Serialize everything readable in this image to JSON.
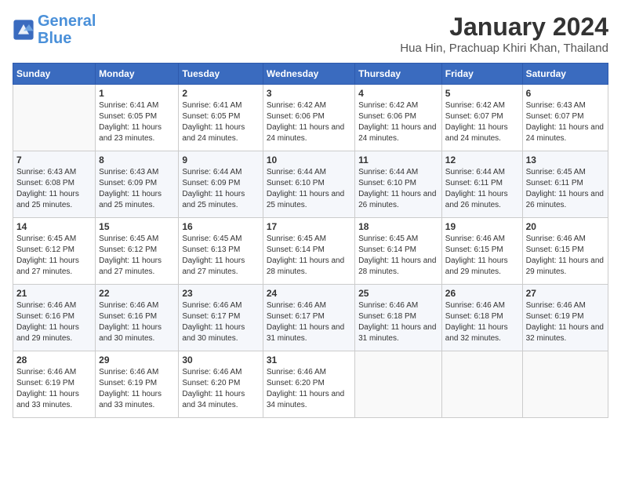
{
  "logo": {
    "line1": "General",
    "line2": "Blue"
  },
  "title": "January 2024",
  "subtitle": "Hua Hin, Prachuap Khiri Khan, Thailand",
  "headers": [
    "Sunday",
    "Monday",
    "Tuesday",
    "Wednesday",
    "Thursday",
    "Friday",
    "Saturday"
  ],
  "weeks": [
    [
      {
        "day": "",
        "sunrise": "",
        "sunset": "",
        "daylight": ""
      },
      {
        "day": "1",
        "sunrise": "Sunrise: 6:41 AM",
        "sunset": "Sunset: 6:05 PM",
        "daylight": "Daylight: 11 hours and 23 minutes."
      },
      {
        "day": "2",
        "sunrise": "Sunrise: 6:41 AM",
        "sunset": "Sunset: 6:05 PM",
        "daylight": "Daylight: 11 hours and 24 minutes."
      },
      {
        "day": "3",
        "sunrise": "Sunrise: 6:42 AM",
        "sunset": "Sunset: 6:06 PM",
        "daylight": "Daylight: 11 hours and 24 minutes."
      },
      {
        "day": "4",
        "sunrise": "Sunrise: 6:42 AM",
        "sunset": "Sunset: 6:06 PM",
        "daylight": "Daylight: 11 hours and 24 minutes."
      },
      {
        "day": "5",
        "sunrise": "Sunrise: 6:42 AM",
        "sunset": "Sunset: 6:07 PM",
        "daylight": "Daylight: 11 hours and 24 minutes."
      },
      {
        "day": "6",
        "sunrise": "Sunrise: 6:43 AM",
        "sunset": "Sunset: 6:07 PM",
        "daylight": "Daylight: 11 hours and 24 minutes."
      }
    ],
    [
      {
        "day": "7",
        "sunrise": "Sunrise: 6:43 AM",
        "sunset": "Sunset: 6:08 PM",
        "daylight": "Daylight: 11 hours and 25 minutes."
      },
      {
        "day": "8",
        "sunrise": "Sunrise: 6:43 AM",
        "sunset": "Sunset: 6:09 PM",
        "daylight": "Daylight: 11 hours and 25 minutes."
      },
      {
        "day": "9",
        "sunrise": "Sunrise: 6:44 AM",
        "sunset": "Sunset: 6:09 PM",
        "daylight": "Daylight: 11 hours and 25 minutes."
      },
      {
        "day": "10",
        "sunrise": "Sunrise: 6:44 AM",
        "sunset": "Sunset: 6:10 PM",
        "daylight": "Daylight: 11 hours and 25 minutes."
      },
      {
        "day": "11",
        "sunrise": "Sunrise: 6:44 AM",
        "sunset": "Sunset: 6:10 PM",
        "daylight": "Daylight: 11 hours and 26 minutes."
      },
      {
        "day": "12",
        "sunrise": "Sunrise: 6:44 AM",
        "sunset": "Sunset: 6:11 PM",
        "daylight": "Daylight: 11 hours and 26 minutes."
      },
      {
        "day": "13",
        "sunrise": "Sunrise: 6:45 AM",
        "sunset": "Sunset: 6:11 PM",
        "daylight": "Daylight: 11 hours and 26 minutes."
      }
    ],
    [
      {
        "day": "14",
        "sunrise": "Sunrise: 6:45 AM",
        "sunset": "Sunset: 6:12 PM",
        "daylight": "Daylight: 11 hours and 27 minutes."
      },
      {
        "day": "15",
        "sunrise": "Sunrise: 6:45 AM",
        "sunset": "Sunset: 6:12 PM",
        "daylight": "Daylight: 11 hours and 27 minutes."
      },
      {
        "day": "16",
        "sunrise": "Sunrise: 6:45 AM",
        "sunset": "Sunset: 6:13 PM",
        "daylight": "Daylight: 11 hours and 27 minutes."
      },
      {
        "day": "17",
        "sunrise": "Sunrise: 6:45 AM",
        "sunset": "Sunset: 6:14 PM",
        "daylight": "Daylight: 11 hours and 28 minutes."
      },
      {
        "day": "18",
        "sunrise": "Sunrise: 6:45 AM",
        "sunset": "Sunset: 6:14 PM",
        "daylight": "Daylight: 11 hours and 28 minutes."
      },
      {
        "day": "19",
        "sunrise": "Sunrise: 6:46 AM",
        "sunset": "Sunset: 6:15 PM",
        "daylight": "Daylight: 11 hours and 29 minutes."
      },
      {
        "day": "20",
        "sunrise": "Sunrise: 6:46 AM",
        "sunset": "Sunset: 6:15 PM",
        "daylight": "Daylight: 11 hours and 29 minutes."
      }
    ],
    [
      {
        "day": "21",
        "sunrise": "Sunrise: 6:46 AM",
        "sunset": "Sunset: 6:16 PM",
        "daylight": "Daylight: 11 hours and 29 minutes."
      },
      {
        "day": "22",
        "sunrise": "Sunrise: 6:46 AM",
        "sunset": "Sunset: 6:16 PM",
        "daylight": "Daylight: 11 hours and 30 minutes."
      },
      {
        "day": "23",
        "sunrise": "Sunrise: 6:46 AM",
        "sunset": "Sunset: 6:17 PM",
        "daylight": "Daylight: 11 hours and 30 minutes."
      },
      {
        "day": "24",
        "sunrise": "Sunrise: 6:46 AM",
        "sunset": "Sunset: 6:17 PM",
        "daylight": "Daylight: 11 hours and 31 minutes."
      },
      {
        "day": "25",
        "sunrise": "Sunrise: 6:46 AM",
        "sunset": "Sunset: 6:18 PM",
        "daylight": "Daylight: 11 hours and 31 minutes."
      },
      {
        "day": "26",
        "sunrise": "Sunrise: 6:46 AM",
        "sunset": "Sunset: 6:18 PM",
        "daylight": "Daylight: 11 hours and 32 minutes."
      },
      {
        "day": "27",
        "sunrise": "Sunrise: 6:46 AM",
        "sunset": "Sunset: 6:19 PM",
        "daylight": "Daylight: 11 hours and 32 minutes."
      }
    ],
    [
      {
        "day": "28",
        "sunrise": "Sunrise: 6:46 AM",
        "sunset": "Sunset: 6:19 PM",
        "daylight": "Daylight: 11 hours and 33 minutes."
      },
      {
        "day": "29",
        "sunrise": "Sunrise: 6:46 AM",
        "sunset": "Sunset: 6:19 PM",
        "daylight": "Daylight: 11 hours and 33 minutes."
      },
      {
        "day": "30",
        "sunrise": "Sunrise: 6:46 AM",
        "sunset": "Sunset: 6:20 PM",
        "daylight": "Daylight: 11 hours and 34 minutes."
      },
      {
        "day": "31",
        "sunrise": "Sunrise: 6:46 AM",
        "sunset": "Sunset: 6:20 PM",
        "daylight": "Daylight: 11 hours and 34 minutes."
      },
      {
        "day": "",
        "sunrise": "",
        "sunset": "",
        "daylight": ""
      },
      {
        "day": "",
        "sunrise": "",
        "sunset": "",
        "daylight": ""
      },
      {
        "day": "",
        "sunrise": "",
        "sunset": "",
        "daylight": ""
      }
    ]
  ]
}
